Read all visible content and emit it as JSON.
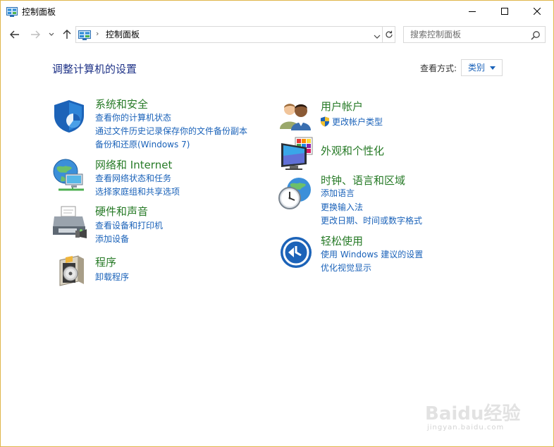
{
  "window": {
    "title": "控制面板"
  },
  "address": {
    "separator": "›",
    "path": "控制面板"
  },
  "search": {
    "placeholder": "搜索控制面板"
  },
  "main": {
    "title": "调整计算机的设置",
    "view_by_label": "查看方式:",
    "view_by_value": "类别"
  },
  "categories": [
    {
      "title": "系统和安全",
      "icon": "shield-icon",
      "links": [
        "查看你的计算机状态",
        "通过文件历史记录保存你的文件备份副本",
        "备份和还原(Windows 7)"
      ]
    },
    {
      "title": "网络和 Internet",
      "icon": "network-globe-icon",
      "links": [
        "查看网络状态和任务",
        "选择家庭组和共享选项"
      ]
    },
    {
      "title": "硬件和声音",
      "icon": "printer-icon",
      "links": [
        "查看设备和打印机",
        "添加设备"
      ]
    },
    {
      "title": "程序",
      "icon": "programs-disc-icon",
      "links": [
        "卸载程序"
      ]
    },
    {
      "title": "用户帐户",
      "icon": "users-icon",
      "links": [
        "更改帐户类型"
      ]
    },
    {
      "title": "外观和个性化",
      "icon": "monitor-palette-icon",
      "links": []
    },
    {
      "title": "时钟、语言和区域",
      "icon": "clock-globe-icon",
      "links": [
        "添加语言",
        "更换输入法",
        "更改日期、时间或数字格式"
      ]
    },
    {
      "title": "轻松使用",
      "icon": "ease-of-access-icon",
      "links": [
        "使用 Windows 建议的设置",
        "优化视觉显示"
      ]
    }
  ],
  "watermark": {
    "text": "Baidu经验",
    "url": "jingyan.baidu.com"
  },
  "colors": {
    "category_title": "#267a26",
    "link": "#1a62b9",
    "page_title": "#1e3287",
    "window_border": "#e0b64a"
  }
}
